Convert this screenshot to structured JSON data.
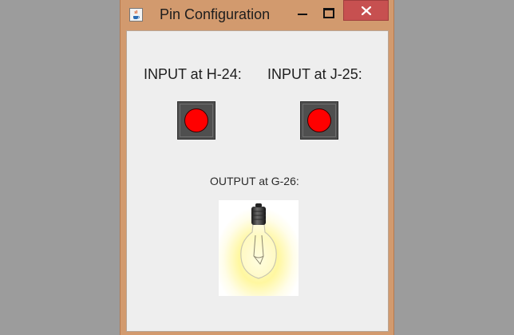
{
  "window": {
    "title": "Pin Configuration",
    "icons": {
      "app": "java-cup-icon",
      "minimize": "minimize-icon",
      "maximize": "maximize-icon",
      "close": "close-icon"
    },
    "colors": {
      "frame": "#d29a6e",
      "close_button": "#c75050",
      "client_background": "#eeeeee"
    }
  },
  "inputs": [
    {
      "label": "INPUT at H-24:",
      "state": "off",
      "indicator_color": "#ff0000"
    },
    {
      "label": "INPUT at J-25:",
      "state": "off",
      "indicator_color": "#ff0000"
    }
  ],
  "output": {
    "label": "OUTPUT at G-26:",
    "icon": "light-bulb-icon",
    "state": "on",
    "glow_color": "#fff7a0"
  }
}
